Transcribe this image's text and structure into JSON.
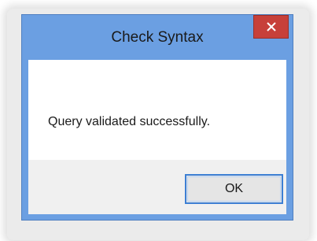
{
  "dialog": {
    "title": "Check Syntax",
    "message": "Query validated successfully.",
    "ok_label": "OK",
    "close_icon": "close-icon"
  },
  "colors": {
    "frame": "#6b9fe2",
    "close_button": "#c7403a",
    "ok_border": "#3c7fd4",
    "client_bg": "#f0f0f0"
  }
}
